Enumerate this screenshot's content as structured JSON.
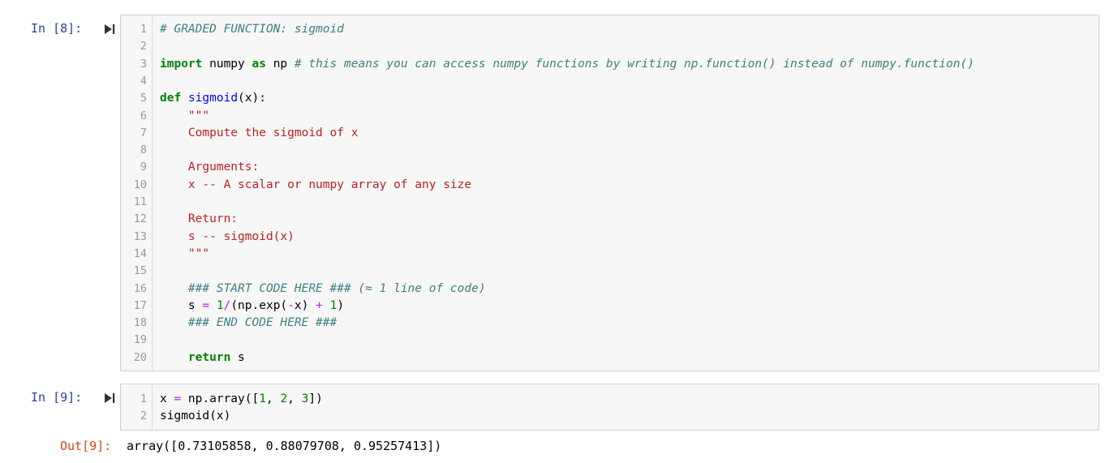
{
  "cell1": {
    "prompt": "In [8]:",
    "lines": [
      {
        "n": "1",
        "segs": [
          {
            "t": "# GRADED FUNCTION: sigmoid",
            "c": "cm"
          }
        ]
      },
      {
        "n": "2",
        "segs": []
      },
      {
        "n": "3",
        "segs": [
          {
            "t": "import",
            "c": "kw"
          },
          {
            "t": " numpy ",
            "c": ""
          },
          {
            "t": "as",
            "c": "kw"
          },
          {
            "t": " np ",
            "c": ""
          },
          {
            "t": "# this means you can access numpy functions by writing np.function() instead of numpy.function()",
            "c": "cm"
          }
        ]
      },
      {
        "n": "4",
        "segs": []
      },
      {
        "n": "5",
        "segs": [
          {
            "t": "def",
            "c": "kw"
          },
          {
            "t": " ",
            "c": ""
          },
          {
            "t": "sigmoid",
            "c": "fn"
          },
          {
            "t": "(x):",
            "c": ""
          }
        ]
      },
      {
        "n": "6",
        "segs": [
          {
            "t": "    \"\"\"",
            "c": "str"
          }
        ]
      },
      {
        "n": "7",
        "segs": [
          {
            "t": "    Compute the sigmoid of x",
            "c": "str"
          }
        ]
      },
      {
        "n": "8",
        "segs": []
      },
      {
        "n": "9",
        "segs": [
          {
            "t": "    Arguments:",
            "c": "str"
          }
        ]
      },
      {
        "n": "10",
        "segs": [
          {
            "t": "    x -- A scalar or numpy array of any size",
            "c": "str"
          }
        ]
      },
      {
        "n": "11",
        "segs": []
      },
      {
        "n": "12",
        "segs": [
          {
            "t": "    Return:",
            "c": "str"
          }
        ]
      },
      {
        "n": "13",
        "segs": [
          {
            "t": "    s -- sigmoid(x)",
            "c": "str"
          }
        ]
      },
      {
        "n": "14",
        "segs": [
          {
            "t": "    \"\"\"",
            "c": "str"
          }
        ]
      },
      {
        "n": "15",
        "segs": []
      },
      {
        "n": "16",
        "segs": [
          {
            "t": "    ",
            "c": ""
          },
          {
            "t": "### START CODE HERE ### (≈ 1 line of code)",
            "c": "cm"
          }
        ]
      },
      {
        "n": "17",
        "segs": [
          {
            "t": "    s ",
            "c": ""
          },
          {
            "t": "=",
            "c": "op"
          },
          {
            "t": " ",
            "c": ""
          },
          {
            "t": "1",
            "c": "num"
          },
          {
            "t": "/",
            "c": "op"
          },
          {
            "t": "(np.exp(",
            "c": ""
          },
          {
            "t": "-",
            "c": "op"
          },
          {
            "t": "x) ",
            "c": ""
          },
          {
            "t": "+",
            "c": "op"
          },
          {
            "t": " ",
            "c": ""
          },
          {
            "t": "1",
            "c": "num"
          },
          {
            "t": ")",
            "c": ""
          }
        ]
      },
      {
        "n": "18",
        "segs": [
          {
            "t": "    ",
            "c": ""
          },
          {
            "t": "### END CODE HERE ###",
            "c": "cm"
          }
        ]
      },
      {
        "n": "19",
        "segs": []
      },
      {
        "n": "20",
        "segs": [
          {
            "t": "    ",
            "c": ""
          },
          {
            "t": "return",
            "c": "kw"
          },
          {
            "t": " s",
            "c": ""
          }
        ]
      }
    ]
  },
  "cell2": {
    "prompt": "In [9]:",
    "lines": [
      {
        "n": "1",
        "segs": [
          {
            "t": "x ",
            "c": ""
          },
          {
            "t": "=",
            "c": "op"
          },
          {
            "t": " np.array([",
            "c": ""
          },
          {
            "t": "1",
            "c": "num"
          },
          {
            "t": ", ",
            "c": ""
          },
          {
            "t": "2",
            "c": "num"
          },
          {
            "t": ", ",
            "c": ""
          },
          {
            "t": "3",
            "c": "num"
          },
          {
            "t": "])",
            "c": ""
          }
        ]
      },
      {
        "n": "2",
        "segs": [
          {
            "t": "sigmoid(x)",
            "c": ""
          }
        ]
      }
    ],
    "out_prompt": "Out[9]:",
    "output": "array([0.73105858, 0.88079708, 0.95257413])"
  },
  "icons": {
    "run": "run-cell-icon"
  },
  "colors": {
    "prompt_in": "#303F9F",
    "prompt_out": "#D84315",
    "editor_bg": "#f7f7f7"
  }
}
